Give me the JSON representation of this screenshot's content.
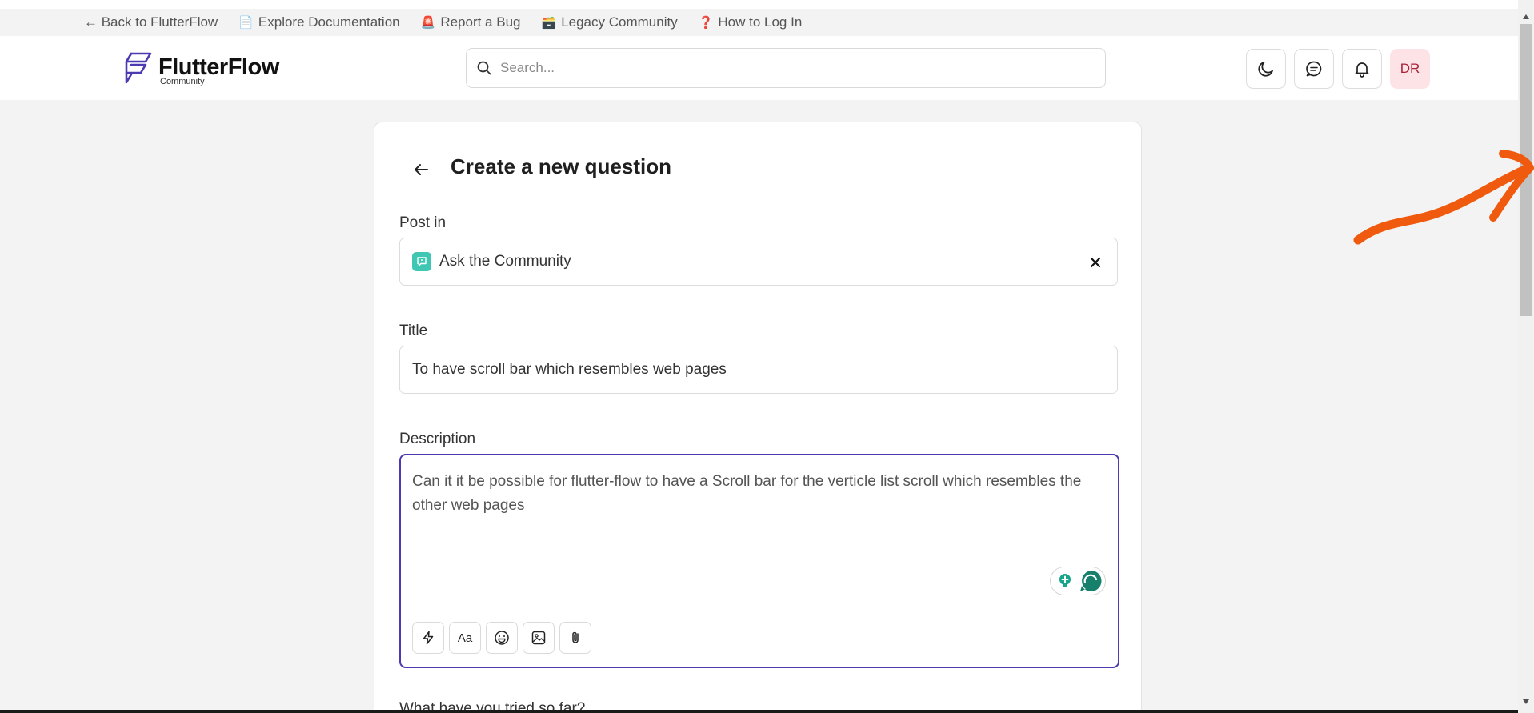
{
  "top_links": [
    {
      "icon": "",
      "label": "← Back to FlutterFlow"
    },
    {
      "icon": "📄",
      "label": "Explore Documentation"
    },
    {
      "icon": "🚨",
      "label": "Report a Bug"
    },
    {
      "icon": "🗃️",
      "label": "Legacy Community"
    },
    {
      "icon": "❓",
      "label": "How to Log In"
    }
  ],
  "header": {
    "logo_title": "FlutterFlow",
    "logo_subtitle": "Community",
    "search_placeholder": "Search...",
    "avatar_initials": "DR"
  },
  "form": {
    "title": "Create a new question",
    "post_in_label": "Post in",
    "post_in_value": "Ask the Community",
    "title_label": "Title",
    "title_value": "To have scroll bar which resembles web pages",
    "description_label": "Description",
    "description_value": "Can it it be possible for flutter-flow to have a Scroll bar for the verticle list scroll which resembles the other web pages",
    "toolbar": [
      "lightning-icon",
      "text-format-icon",
      "emoji-icon",
      "image-icon",
      "attachment-icon"
    ],
    "text_format_glyph": "Aa",
    "next_label": "What have you tried so far?"
  },
  "colors": {
    "accent": "#4b3bb0",
    "community_badge": "#3fc7b4",
    "avatar_bg": "#fde3e6",
    "annotation": "#f05a0f"
  }
}
